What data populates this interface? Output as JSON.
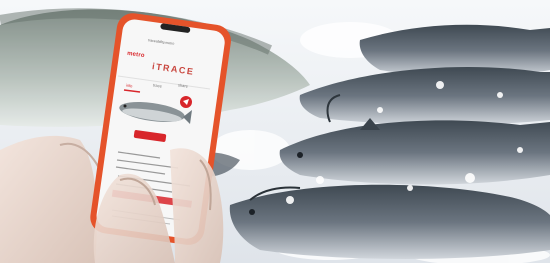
{
  "phone": {
    "url": "traceability.metro",
    "brand": "metro",
    "app_title": "iTRACE",
    "tabs": [
      "info",
      "trace",
      "share"
    ]
  },
  "colors": {
    "phone_case": "#e5532a",
    "accent_red": "#d8262b",
    "ice": "#eef1f4",
    "fish_back": "#4f5962",
    "fish_belly": "#c7ccd2"
  }
}
